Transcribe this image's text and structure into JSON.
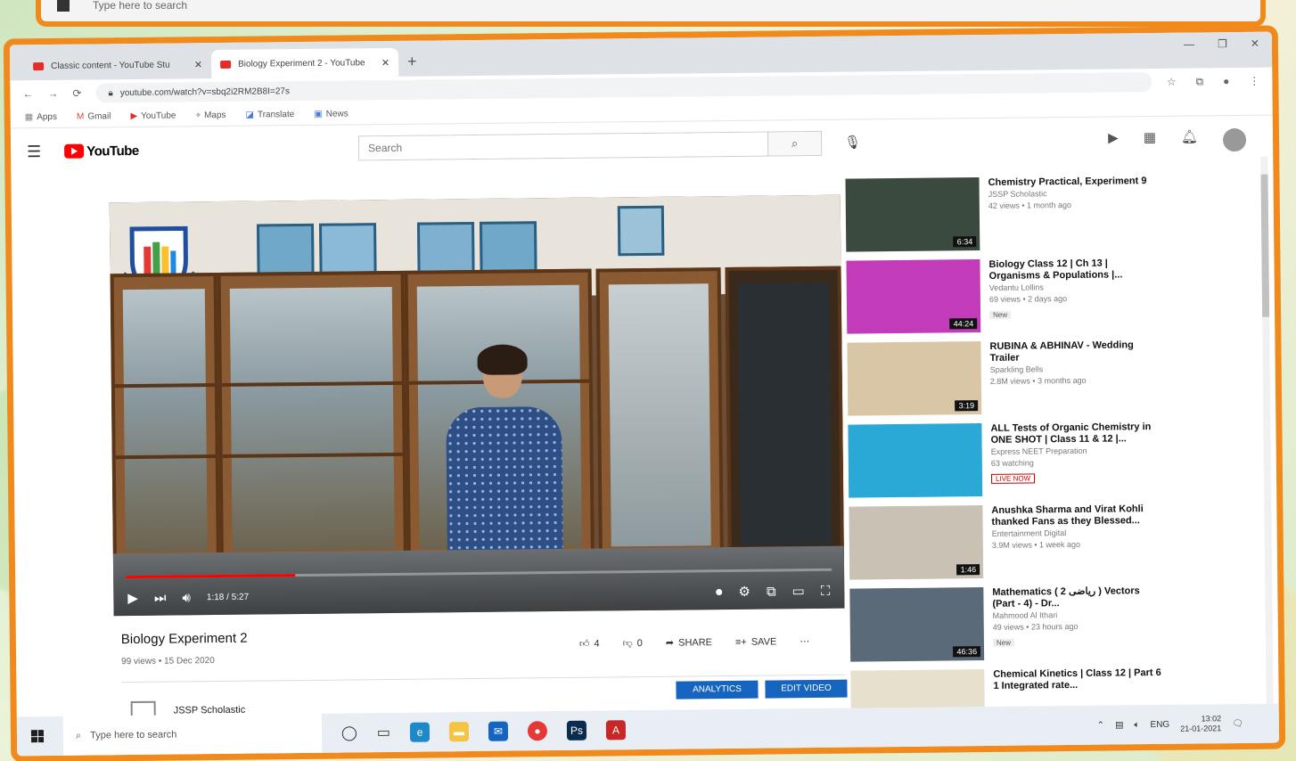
{
  "back_taskbar": {
    "search_placeholder": "Type here to search"
  },
  "browser": {
    "tabs": [
      {
        "label": "Classic content - YouTube Stu",
        "active": false
      },
      {
        "label": "Biology Experiment 2 - YouTube",
        "active": true
      }
    ],
    "url": "youtube.com/watch?v=sbq2i2RM2B8I=27s",
    "bookmarks": [
      "Apps",
      "Gmail",
      "YouTube",
      "Maps",
      "Translate",
      "News"
    ]
  },
  "youtube": {
    "search_placeholder": "Search",
    "video": {
      "title": "Biology Experiment 2",
      "meta": "99 views • 15 Dec 2020",
      "time": "1:18 / 5:27",
      "progress": 0.24,
      "likes": "4",
      "dislikes": "0",
      "share_label": "SHARE",
      "save_label": "SAVE",
      "channel": "JSSP Scholastic",
      "analytics_label": "ANALYTICS",
      "edit_label": "EDIT VIDEO"
    },
    "recommendations": [
      {
        "title": "Chemistry Practical, Experiment 9",
        "channel": "JSSP Scholastic",
        "views": "42 views • 1 month ago",
        "duration": "6:34",
        "badge": "",
        "thumb_color": "#3b4a3f"
      },
      {
        "title": "Biology Class 12 | Ch 13 | Organisms & Populations |...",
        "channel": "Vedantu Lollins",
        "views": "69 views • 2 days ago",
        "duration": "44:24",
        "badge": "New",
        "thumb_color": "#c23bb8"
      },
      {
        "title": "RUBINA & ABHINAV - Wedding Trailer",
        "channel": "Sparkling Bells",
        "views": "2.8M views • 3 months ago",
        "duration": "3:19",
        "badge": "",
        "thumb_color": "#d9c6a6"
      },
      {
        "title": "ALL Tests of Organic Chemistry in ONE SHOT | Class 11 & 12 |...",
        "channel": "Express NEET Preparation",
        "views": "63 watching",
        "duration": "",
        "badge": "LIVE NOW",
        "thumb_color": "#2aa8d6"
      },
      {
        "title": "Anushka Sharma and Virat Kohli thanked Fans as they Blessed...",
        "channel": "Entertainment Digital",
        "views": "3.9M views • 1 week ago",
        "duration": "1:46",
        "badge": "",
        "thumb_color": "#c9c1b3"
      },
      {
        "title": "Mathematics ( 2 ریاضی ) Vectors (Part - 4) - Dr...",
        "channel": "Mahmood Al Ithari",
        "views": "49 views • 23 hours ago",
        "duration": "46:36",
        "badge": "New",
        "thumb_color": "#5b6a78"
      },
      {
        "title": "Chemical Kinetics | Class 12 | Part 6 1 Integrated rate...",
        "channel": "",
        "views": "",
        "duration": "",
        "badge": "",
        "thumb_color": "#e6e0cc"
      }
    ]
  },
  "taskbar": {
    "search_placeholder": "Type here to search",
    "lang": "ENG",
    "time": "13:02",
    "date": "21-01-2021"
  },
  "colors": {
    "frame": "#f08a1c",
    "youtube_red": "#ff0000",
    "button_blue": "#1565c0"
  }
}
